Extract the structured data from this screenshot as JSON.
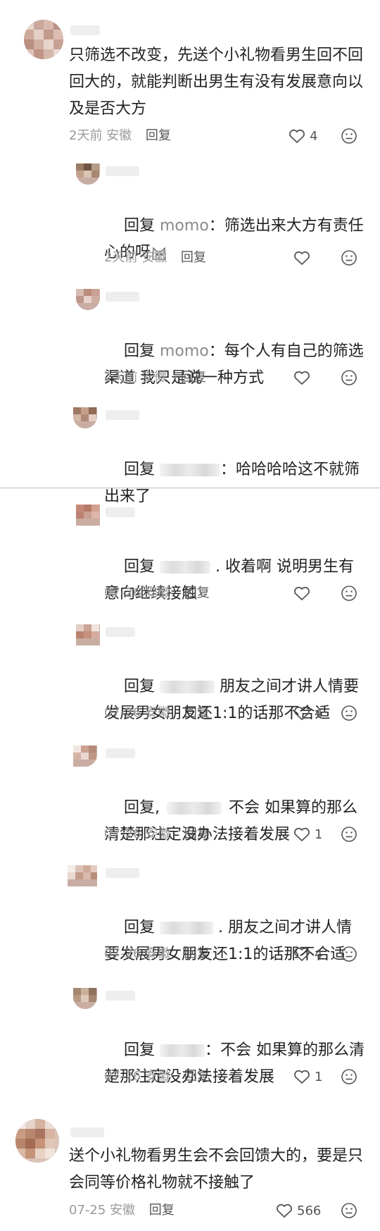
{
  "comments": [
    {
      "text": "只筛选不改变，先送个小礼物看男生回不回回大的，就能判断出男生有没有发展意向以及是否大方",
      "meta": "2天前 安徽",
      "reply_label": "回复",
      "likes": "4"
    },
    {
      "reply_word": "回复",
      "target": "momo",
      "text": "：筛选出来大方有责任心的呀",
      "meta": "2天前 安徽",
      "reply_label": "回复",
      "likes": ""
    },
    {
      "reply_word": "回复",
      "target": "momo",
      "text": "：每个人有自己的筛选渠道 我只是说一种方式",
      "meta": "2天前 安徽",
      "reply_label": "回复",
      "likes": ""
    },
    {
      "reply_word": "回复",
      "text": "：哈哈哈哈这不就筛出来了"
    },
    {
      "reply_word": "回复",
      "text": ". 收着啊 说明男生有意向继续接触",
      "meta": "07-26 安徽",
      "reply_label": "回复",
      "likes": ""
    },
    {
      "reply_word": "回复",
      "text": "朋友之间才讲人情要发展男女朋友还1:1的话那不合适",
      "meta": "07-26 安徽",
      "reply_label": "回复",
      "likes": "4"
    },
    {
      "reply_word": "回复,",
      "text": "不会 如果算的那么清楚那注定没办法接着发展",
      "meta": "07-26 安徽",
      "reply_label": "回复",
      "likes": "1"
    },
    {
      "reply_word": "回复",
      "text": ". 朋友之间才讲人情要发展男女朋友还1:1的话那不合适",
      "meta": "07-26 安徽",
      "reply_label": "回复",
      "likes": "4"
    },
    {
      "reply_word": "回复",
      "text": "：不会 如果算的那么清楚那注定没办法接着发展",
      "meta": "07-26 安徽",
      "reply_label": "回复",
      "likes": "1"
    },
    {
      "text": "送个小礼物看男生会不会回馈大的，要是只会同等价格礼物就不接触了",
      "meta": "07-25 安徽",
      "reply_label": "回复",
      "likes": "566"
    }
  ],
  "colors": {
    "text": "#222222",
    "meta": "#9a9a9a",
    "mention": "#8a8a8a",
    "divider": "#bdbdbd"
  }
}
